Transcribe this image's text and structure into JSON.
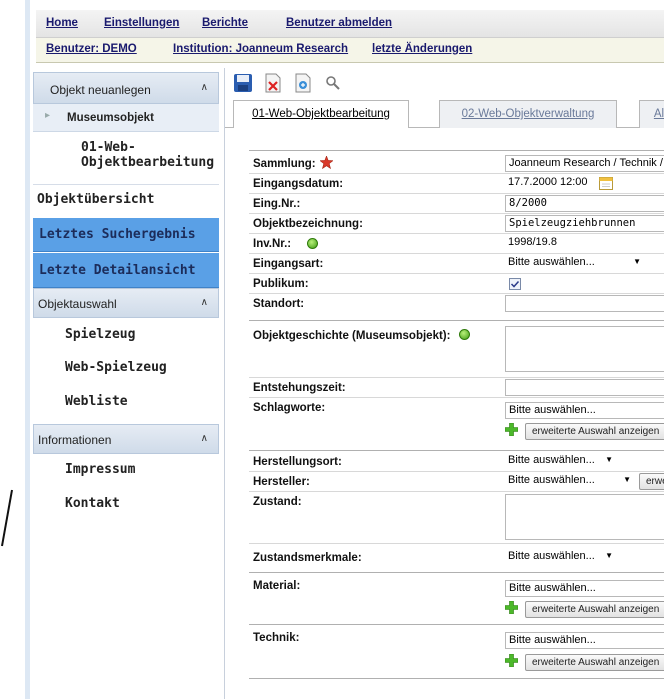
{
  "topnav": {
    "home": "Home",
    "einstellungen": "Einstellungen",
    "berichte": "Berichte",
    "abmelden": "Benutzer abmelden"
  },
  "subnav": {
    "benutzer": "Benutzer: DEMO",
    "institution": "Institution: Joanneum Research",
    "aenderungen": "letzte Änderungen"
  },
  "sidebar": {
    "section1": {
      "label": "Objekt neuanlegen",
      "chevron": "^"
    },
    "museumsobjekt": "Museumsobjekt",
    "webbearbeitung_1": "01-Web-",
    "webbearbeitung_2": "Objektbearbeitung",
    "objektuebersicht": "Objektübersicht",
    "suchergebnis": "Letztes Suchergebnis",
    "detailansicht": "Letzte Detailansicht",
    "section2": {
      "label": "Objektauswahl",
      "chevron": "^"
    },
    "spielzeug": "Spielzeug",
    "webspielzeug": "Web-Spielzeug",
    "webliste": "Webliste",
    "section3": {
      "label": "Informationen",
      "chevron": "^"
    },
    "impressum": "Impressum",
    "kontakt": "Kontakt"
  },
  "toolbar": {
    "icons": [
      "save-icon",
      "delete-icon",
      "export-icon",
      "search-icon"
    ]
  },
  "tabs": [
    {
      "label": "01-Web-Objektbearbeitung"
    },
    {
      "label": "02-Web-Objektverwaltung"
    },
    {
      "label": "Al"
    }
  ],
  "form": {
    "sammlung": {
      "label": "Sammlung:",
      "value": "Joanneum Research / Technik / Sp"
    },
    "eingangsdatum": {
      "label": "Eingangsdatum:",
      "value": "17.7.2000 12:00"
    },
    "eingnr": {
      "label": "Eing.Nr.:",
      "value": "8/2000"
    },
    "objektbezeichnung": {
      "label": "Objektbezeichnung:",
      "value": "Spielzeugziehbrunnen"
    },
    "invnr": {
      "label": "Inv.Nr.:",
      "value": "1998/19.8"
    },
    "eingangsart": {
      "label": "Eingangsart:",
      "value": "Bitte auswählen..."
    },
    "publikum": {
      "label": "Publikum:",
      "checked": true
    },
    "standort": {
      "label": "Standort:",
      "value": ""
    },
    "objektgeschichte": {
      "label": "Objektgeschichte (Museumsobjekt):",
      "value": ""
    },
    "entstehungszeit": {
      "label": "Entstehungszeit:",
      "value": ""
    },
    "schlagworte": {
      "label": "Schlagworte:",
      "value": "Bitte auswählen...",
      "button": "erweiterte Auswahl anzeigen"
    },
    "herstellungsort": {
      "label": "Herstellungsort:",
      "value": "Bitte auswählen..."
    },
    "hersteller": {
      "label": "Hersteller:",
      "value": "Bitte auswählen...",
      "button": "erweite"
    },
    "zustand": {
      "label": "Zustand:",
      "value": ""
    },
    "zustandsmerkmale": {
      "label": "Zustandsmerkmale:",
      "value": "Bitte auswählen..."
    },
    "material": {
      "label": "Material:",
      "value": "Bitte auswählen...",
      "button": "erweiterte Auswahl anzeigen"
    },
    "technik": {
      "label": "Technik:",
      "value": "Bitte auswählen...",
      "button": "erweiterte Auswahl anzeigen"
    }
  },
  "colors": {
    "sidebar_active": "#5aa0e6",
    "link": "#1a1a6e",
    "required_star": "#d93a2b",
    "help_icon": "#3e9b12"
  }
}
